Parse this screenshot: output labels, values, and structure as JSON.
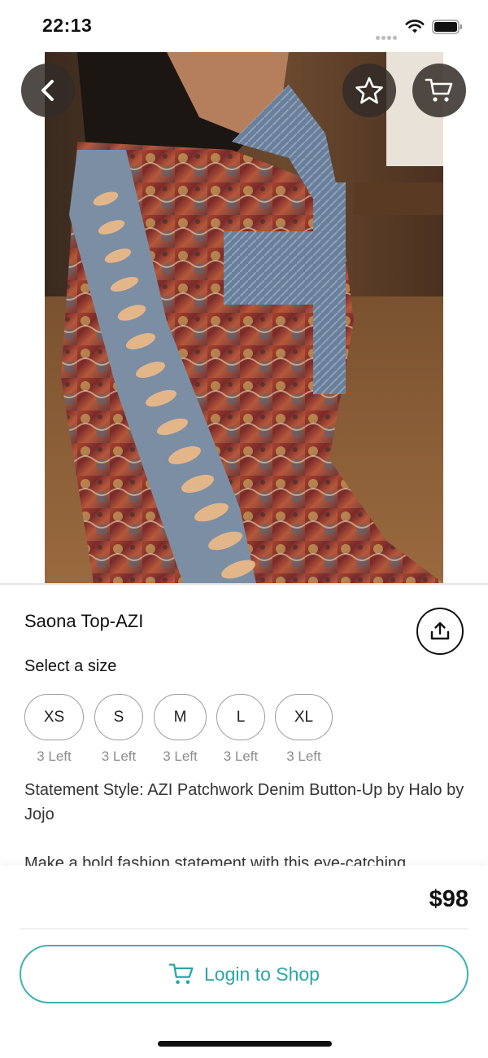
{
  "status_bar": {
    "time": "22:13"
  },
  "product": {
    "title": "Saona Top-AZI",
    "price": "$98",
    "size_label": "Select a size",
    "sizes": [
      {
        "label": "XS",
        "stock": "3 Left"
      },
      {
        "label": "S",
        "stock": "3 Left"
      },
      {
        "label": "M",
        "stock": "3 Left"
      },
      {
        "label": "L",
        "stock": "3 Left"
      },
      {
        "label": "XL",
        "stock": "3 Left"
      }
    ],
    "description": "Statement Style: AZI Patchwork Denim Button-Up by Halo by Jojo",
    "description_more": "Make a bold fashion statement with this eye-catching"
  },
  "gallery": {
    "page_count": 4,
    "active_page": 2
  },
  "actions": {
    "login_label": "Login to Shop"
  },
  "icons": {
    "back": "chevron-left-icon",
    "favorite": "star-outline-icon",
    "cart": "cart-icon",
    "share": "share-icon",
    "login": "cart-icon"
  },
  "colors": {
    "accent": "#2aa6a6",
    "button_overlay": "#322c28"
  }
}
